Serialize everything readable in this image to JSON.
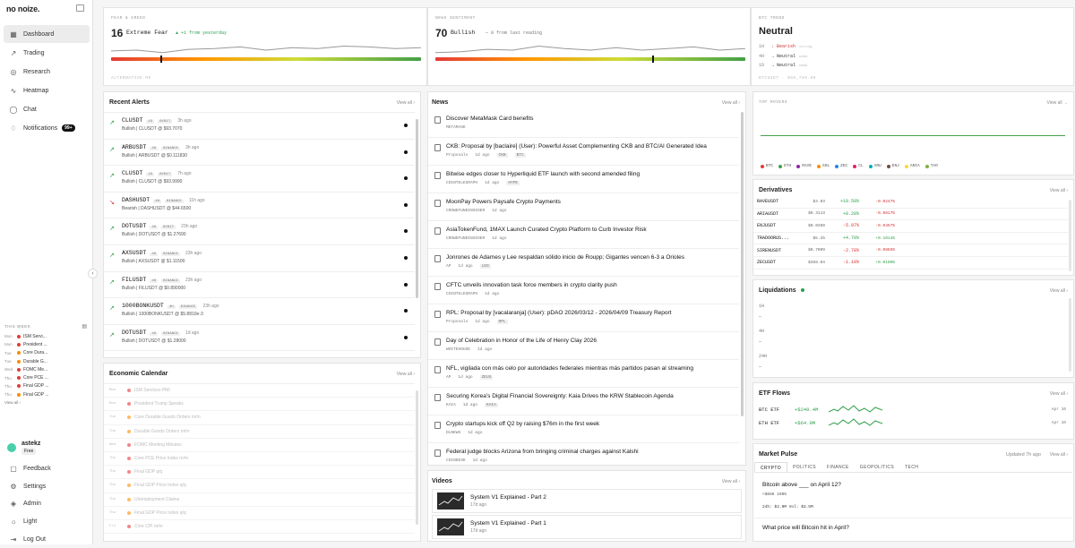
{
  "app": {
    "logo": "no noize.",
    "collapse_glyph": "‹"
  },
  "nav": [
    {
      "label": "Dashboard",
      "icon": "▦",
      "icon_name": "grid-icon",
      "active": true
    },
    {
      "label": "Trading",
      "icon": "↗",
      "icon_name": "trending-icon"
    },
    {
      "label": "Research",
      "icon": "◎",
      "icon_name": "compass-icon"
    },
    {
      "label": "Heatmap",
      "icon": "∿",
      "icon_name": "activity-icon"
    },
    {
      "label": "Chat",
      "icon": "◯",
      "icon_name": "chat-icon"
    },
    {
      "label": "Notifications",
      "icon": "♢",
      "icon_name": "bell-icon",
      "badge": "99+"
    }
  ],
  "this_week": {
    "title": "THIS WEEK",
    "calendar_glyph": "▤",
    "items": [
      {
        "day": "Mon",
        "label": "ISM Servi...",
        "color": "#e53935"
      },
      {
        "day": "Mon",
        "label": "President ...",
        "color": "#e53935"
      },
      {
        "day": "Tue",
        "label": "Core Dura...",
        "color": "#fb8c00"
      },
      {
        "day": "Tue",
        "label": "Durable G...",
        "color": "#fb8c00"
      },
      {
        "day": "Wed",
        "label": "FOMC Me...",
        "color": "#e53935"
      },
      {
        "day": "Thu",
        "label": "Core PCE ...",
        "color": "#e53935"
      },
      {
        "day": "Thu",
        "label": "Final GDP ...",
        "color": "#e53935"
      },
      {
        "day": "Thu",
        "label": "Final GDP ...",
        "color": "#fb8c00"
      }
    ],
    "view_all": "View all ›"
  },
  "user": {
    "name": "astekz",
    "plan": "Free"
  },
  "bottom_nav": [
    {
      "label": "Feedback",
      "icon": "▢",
      "icon_name": "feedback-icon"
    },
    {
      "label": "Settings",
      "icon": "⚙",
      "icon_name": "gear-icon"
    },
    {
      "label": "Admin",
      "icon": "◈",
      "icon_name": "shield-icon"
    },
    {
      "label": "Light",
      "icon": "☼",
      "icon_name": "sun-icon"
    },
    {
      "label": "Log Out",
      "icon": "⇥",
      "icon_name": "logout-icon"
    }
  ],
  "fear_greed": {
    "title": "FEAR & GREED",
    "value": "16",
    "label": "Extreme Fear",
    "change": "▲ +1 from yesterday",
    "footer": "ALTERNATIVE.ME",
    "level": 0.16
  },
  "news_sentiment": {
    "title": "NEWS SENTIMENT",
    "value": "70",
    "label": "Bullish",
    "change": "— 0 from last reading",
    "level": 0.7
  },
  "btc_trend": {
    "title": "BTC TREND",
    "value": "Neutral",
    "rows": [
      {
        "tf": "1H",
        "sym": "↓",
        "label": "Bearish",
        "note": "strong",
        "color": "#d32f2f"
      },
      {
        "tf": "4H",
        "sym": "→",
        "label": "Neutral",
        "note": "weak",
        "color": "#333"
      },
      {
        "tf": "1D",
        "sym": "→",
        "label": "Neutral",
        "note": "weak",
        "color": "#333"
      }
    ],
    "footer": "BTCUSDT · $66,789.00"
  },
  "alerts": {
    "title": "Recent Alerts",
    "view_all": "View all ›",
    "items": [
      {
        "sym": "CLUSDT",
        "tf": "1D",
        "ex": "BYBIT",
        "time": "3h ago",
        "text": "Bullish | CLUSDT @ $93.7070",
        "bull": true
      },
      {
        "sym": "ARBUSDT",
        "tf": "4H",
        "ex": "BINANCE",
        "time": "3h ago",
        "text": "Bullish | ARBUSDT @ $0.111830",
        "bull": true
      },
      {
        "sym": "CLUSDT",
        "tf": "1D",
        "ex": "BYBIT",
        "time": "7h ago",
        "text": "Bullish | CLUSDT @ $93.9990",
        "bull": true
      },
      {
        "sym": "DASHUSDT",
        "tf": "4H",
        "ex": "BINANCE",
        "time": "11h ago",
        "text": "Bearish | DASHUSDT @ $44.6500",
        "bull": false
      },
      {
        "sym": "DOTUSDT",
        "tf": "4H",
        "ex": "BYBIT",
        "time": "23h ago",
        "text": "Bullish | DOTUSDT @ $1.27690",
        "bull": true
      },
      {
        "sym": "AXSUSDT",
        "tf": "4H",
        "ex": "BINANCE",
        "time": "23h ago",
        "text": "Bullish | AXSUSDT @ $1.11500",
        "bull": true
      },
      {
        "sym": "FILUSDT",
        "tf": "4H",
        "ex": "BINANCE",
        "time": "23h ago",
        "text": "Bullish | FILUSDT @ $0.890000",
        "bull": true
      },
      {
        "sym": "1000BONKUSDT",
        "tf": "4H",
        "ex": "BINANCE",
        "time": "23h ago",
        "text": "Bullish | 1000BONKUSDT @ $5.8810e-3",
        "bull": true
      },
      {
        "sym": "DOTUSDT",
        "tf": "4H",
        "ex": "BINANCE",
        "time": "1d ago",
        "text": "Bullish | DOTUSDT @ $1.28000",
        "bull": true
      }
    ]
  },
  "news": {
    "title": "News",
    "view_all": "View all ›",
    "items": [
      {
        "title": "Discover MetaMask Card benefits",
        "src": "METAMASK",
        "time": "",
        "tags": []
      },
      {
        "title": "CKB: Proposal by [baclaire] (User): Powerful Asset Complementing CKB and BTC/AI Generated Idea",
        "src": "Proposals",
        "time": "1d ago",
        "tags": [
          "CKB",
          "BTC"
        ]
      },
      {
        "title": "Bitwise edges closer to Hyperliquid ETF launch with second amended filing",
        "src": "COINTELEGRAPH",
        "time": "1d ago",
        "tags": [
          "HYPE"
        ]
      },
      {
        "title": "MoonPay Powers Paysafe Crypto Payments",
        "src": "CROWDFUNDINSIDER",
        "time": "1d ago",
        "tags": []
      },
      {
        "title": "AsiaTokenFund, 1MAX Launch Curated Crypto Platform to Curb Investor Risk",
        "src": "CROWDFUNDINSIDER",
        "time": "1d ago",
        "tags": []
      },
      {
        "title": "Jonrones de Adames y Lee respaldan sólido inicio de Roupp; Gigantes vencen 6-3 a Orioles",
        "src": "AP",
        "time": "1d ago",
        "tags": [
          "LDO"
        ]
      },
      {
        "title": "CFTC unveils innovation task force members in crypto clarity push",
        "src": "COINTELEGRAPH",
        "time": "1d ago",
        "tags": []
      },
      {
        "title": "RPL: Proposal by [vacalaranja] (User): pDAO 2026/03/12 - 2026/04/09 Treasury Report",
        "src": "Proposals",
        "time": "1d ago",
        "tags": [
          "RPL"
        ]
      },
      {
        "title": "Day of Celebration in Honor of the Life of Henry Clay 2026",
        "src": "WHITEHOUSE",
        "time": "1d ago",
        "tags": []
      },
      {
        "title": "NFL, vigilada con más celo por autoridades federales mientras más partidos pasan al streaming",
        "src": "AP",
        "time": "1d ago",
        "tags": [
          "ZEUS"
        ]
      },
      {
        "title": "Securing Korea’s Digital Financial Sovereignty: Kaia Drives the KRW Stablecoin Agenda",
        "src": "KAIA",
        "time": "1d ago",
        "tags": [
          "KAIA"
        ]
      },
      {
        "title": "Crypto startups kick off Q2 by raising $76m in the first week",
        "src": "DLNEWS",
        "time": "1d ago",
        "tags": []
      },
      {
        "title": "Federal judge blocks Arizona from bringing criminal charges against Kalshi",
        "src": "COINDESK",
        "time": "1d ago",
        "tags": []
      }
    ]
  },
  "calendar": {
    "title": "Economic Calendar",
    "view_all": "View all ›",
    "items": [
      {
        "day": "Mon",
        "label": "ISM Services PMI",
        "color": "#e53935"
      },
      {
        "day": "Mon",
        "label": "President Trump Speaks",
        "color": "#e53935"
      },
      {
        "day": "Tue",
        "label": "Core Durable Goods Orders m/m",
        "color": "#fb8c00"
      },
      {
        "day": "Tue",
        "label": "Durable Goods Orders m/m",
        "color": "#fb8c00"
      },
      {
        "day": "Wed",
        "label": "FOMC Meeting Minutes",
        "color": "#e53935"
      },
      {
        "day": "Thu",
        "label": "Core PCE Price Index m/m",
        "color": "#e53935"
      },
      {
        "day": "Thu",
        "label": "Final GDP q/q",
        "color": "#e53935"
      },
      {
        "day": "Thu",
        "label": "Final GDP Price Index q/q",
        "color": "#fb8c00"
      },
      {
        "day": "Thu",
        "label": "Unemployment Claims",
        "color": "#fb8c00"
      },
      {
        "day": "Thu",
        "label": "Final GDP Price Index q/q",
        "color": "#fb8c00"
      },
      {
        "day": "Fri",
        "label": "Core CPI m/m",
        "color": "#e53935"
      }
    ]
  },
  "videos": {
    "title": "Videos",
    "view_all": "View all ›",
    "items": [
      {
        "title": "System V1 Explained - Part 2",
        "time": "17d ago"
      },
      {
        "title": "System V1 Explained - Part 1",
        "time": "17d ago"
      }
    ]
  },
  "top_movers": {
    "title": "TOP MOVERS",
    "view_all": "View all →",
    "legend": [
      {
        "name": "BTC",
        "color": "#e53935"
      },
      {
        "name": "ETH",
        "color": "#43a047"
      },
      {
        "name": "RAVE",
        "color": "#8e24aa"
      },
      {
        "name": "SOL",
        "color": "#fb8c00"
      },
      {
        "name": "ZEC",
        "color": "#1e88e5"
      },
      {
        "name": "CL",
        "color": "#e91e63"
      },
      {
        "name": "ARU",
        "color": "#00acc1"
      },
      {
        "name": "ENJ",
        "color": "#6d4c41"
      },
      {
        "name": "ARIA",
        "color": "#fdd835"
      },
      {
        "name": "TAO",
        "color": "#7cb342"
      }
    ]
  },
  "derivatives": {
    "title": "Derivatives",
    "view_all": "View all ›",
    "rows": [
      {
        "sym": "RAVEUSDT",
        "price": "$3.03",
        "chg": "+19.58%",
        "up": true,
        "fund": "-0.0247%"
      },
      {
        "sym": "ARIAUSDT",
        "price": "$0.3113",
        "chg": "+8.20%",
        "up": true,
        "fund": "-0.0817%"
      },
      {
        "sym": "ENJUSDT",
        "price": "$0.0350",
        "chg": "-5.97%",
        "up": false,
        "fund": "-0.0457%"
      },
      {
        "sym": "TRADOORUS...",
        "price": "$5.25",
        "chg": "+4.70%",
        "up": true,
        "fund": "+0.1014%"
      },
      {
        "sym": "SIRENUSDT",
        "price": "$0.7009",
        "chg": "-2.78%",
        "up": false,
        "fund": "-0.0865%"
      },
      {
        "sym": "ZECUSDT",
        "price": "$368.04",
        "chg": "-1.10%",
        "up": false,
        "fund": "+0.0100%"
      }
    ]
  },
  "liquidations": {
    "title": "Liquidations",
    "view_all": "View all ›",
    "rows": [
      {
        "label": "1H",
        "value": "—"
      },
      {
        "label": "4H",
        "value": "—"
      },
      {
        "label": "24H",
        "value": "—"
      }
    ]
  },
  "etf_flows": {
    "title": "ETF Flows",
    "view_all": "View all ›",
    "rows": [
      {
        "name": "BTC ETF",
        "value": "+$240.4M",
        "date": "Apr 10"
      },
      {
        "name": "ETH ETF",
        "value": "+$64.9M",
        "date": "Apr 10"
      }
    ]
  },
  "market_pulse": {
    "title": "Market Pulse",
    "updated": "Updated 7h ago",
    "view_all": "View all ›",
    "tabs": [
      "CRYPTO",
      "POLITICS",
      "FINANCE",
      "GEOPOLITICS",
      "TECH"
    ],
    "q1": "Bitcoin above ___ on April 12?",
    "q1_sub": "<$66K 100%",
    "q1_stats": "24h: $2.0M   Vol: $3.5M",
    "q2": "What price will Bitcoin hit in April?"
  },
  "colors": {
    "bull": "#2e9e4a",
    "bear": "#d32f2f"
  }
}
